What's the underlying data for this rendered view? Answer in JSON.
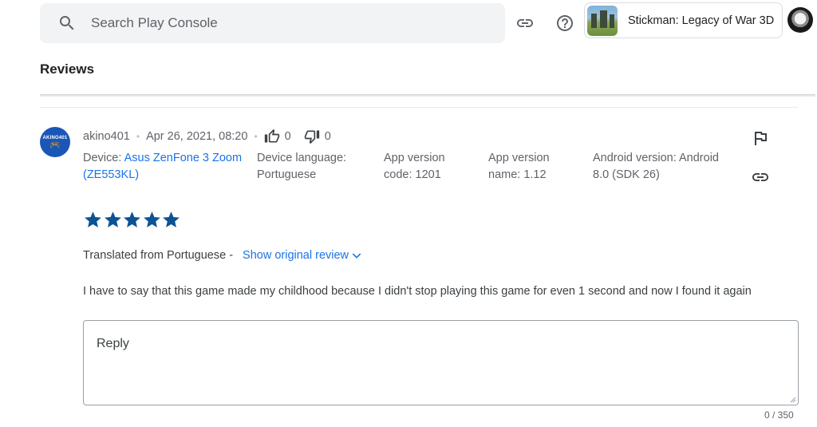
{
  "header": {
    "search_placeholder": "Search Play Console",
    "icons": [
      "search-icon",
      "link-icon",
      "help-icon"
    ],
    "app": {
      "name": "Stickman: Legacy of War 3D"
    }
  },
  "page": {
    "title": "Reviews"
  },
  "review": {
    "author": "akino401",
    "date": "Apr 26, 2021, 08:20",
    "thumbs_up": "0",
    "thumbs_down": "0",
    "avatar_text": "AKINO401",
    "device_label": "Device:",
    "device_line1": "Asus ZenFone 3 Zoom",
    "device_line2": "(ZE553KL)",
    "language_line1": "Device language:",
    "language_line2": "Portuguese",
    "version_code_line1": "App version",
    "version_code_line2": "code: 1201",
    "version_name_line1": "App version",
    "version_name_line2": "name: 1.12",
    "android_line1": "Android version: Android",
    "android_line2": "8.0 (SDK 26)",
    "rating": 5,
    "star_color": "#0b5394",
    "translated_label": "Translated from Portuguese -",
    "show_original_label": "Show original review",
    "text": "I have to say that this game made my childhood because I didn't stop playing this game for even 1 second and now I found it again"
  },
  "reply": {
    "placeholder": "Reply",
    "counter": "0 / 350"
  },
  "colors": {
    "accent": "#1a73e8",
    "text": "#3c4043",
    "muted": "#5f6368"
  }
}
